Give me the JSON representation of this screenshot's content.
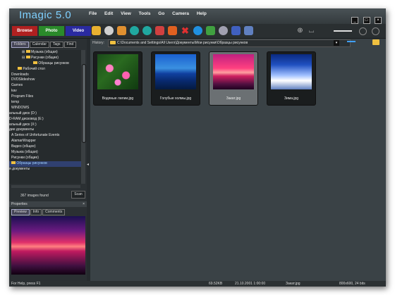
{
  "app": {
    "name": "Imagic",
    "version": "5.0"
  },
  "menu": [
    "File",
    "Edit",
    "View",
    "Tools",
    "Go",
    "Camera",
    "Help"
  ],
  "modes": {
    "browse": "Browse",
    "photo": "Photo",
    "video": "Video"
  },
  "sidebar": {
    "tabs": [
      "Folders",
      "Calendar",
      "Tags",
      "Find"
    ],
    "tree": [
      "Музыка (общая)",
      "Рисунки (общие)",
      "Образцы рисунков",
      "Рабочий стол",
      "Downloads",
      "DVDSlideshow",
      "Games",
      "kav",
      "Program Files",
      "temp",
      "WINDOWS",
      "альный диск (D:)",
      "D-RAM дисковод (E:)",
      "альный диск (X:)",
      "дие документы",
      "A Series of Unfortunate Events",
      "AlamarWrapper",
      "Видео (общее)",
      "Музыка (общая)",
      "Рисунки (общие)",
      "Образцы рисунков",
      "я документы"
    ],
    "count_text": "367 images found",
    "scan_label": "Scan"
  },
  "properties": {
    "title": "Properties",
    "tabs": [
      "Preview",
      "Info",
      "Comments"
    ]
  },
  "main": {
    "history_label": "History:",
    "path": "C:\\Documents and Settings\\All Users\\Документы\\Мои рисунки\\Образцы рисунков",
    "thumbnails": [
      {
        "caption": "Водяные лилии.jpg"
      },
      {
        "caption": "Голубые холмы.jpg"
      },
      {
        "caption": "Закат.jpg"
      },
      {
        "caption": "Зима.jpg"
      }
    ]
  },
  "status": {
    "help": "For Help, press F1",
    "size": "69.52KB",
    "date": "21.10.2001 1:00:00",
    "file": "Закат.jpg",
    "dims": "800x600, 24 bits"
  }
}
